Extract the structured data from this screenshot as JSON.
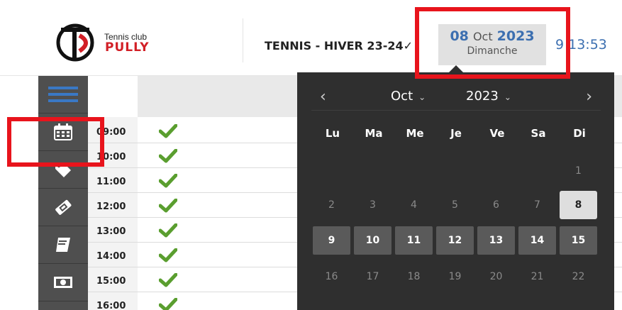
{
  "header": {
    "club_tennis": "Tennis club",
    "club_name": "PULLY",
    "season_label": "TENNIS - HIVER 23-24",
    "season_chevron": "✓",
    "date": {
      "day": "08",
      "month": "Oct",
      "year": "2023",
      "weekday": "Dimanche"
    },
    "clock": "9 13:53"
  },
  "sidebar": {
    "items": [
      "menu-icon",
      "calendar-icon",
      "tag-icon",
      "ticket-icon",
      "book-icon",
      "money-icon"
    ]
  },
  "schedule": {
    "times": [
      "09:00",
      "10:00",
      "11:00",
      "12:00",
      "13:00",
      "14:00",
      "15:00",
      "16:00"
    ]
  },
  "datepicker": {
    "prev": "‹",
    "next": "›",
    "month": "Oct",
    "year": "2023",
    "chevron": "⌄",
    "weekdays": [
      "Lu",
      "Ma",
      "Me",
      "Je",
      "Ve",
      "Sa",
      "Di"
    ],
    "weeks": [
      [
        "",
        "",
        "",
        "",
        "",
        "",
        "1"
      ],
      [
        "2",
        "3",
        "4",
        "5",
        "6",
        "7",
        "8"
      ],
      [
        "9",
        "10",
        "11",
        "12",
        "13",
        "14",
        "15"
      ],
      [
        "16",
        "17",
        "18",
        "19",
        "20",
        "21",
        "22"
      ]
    ],
    "selected": "8"
  },
  "colors": {
    "accent": "#3c6fb0",
    "highlight_red": "#e8141c",
    "check_green": "#5a9e2f",
    "sidebar": "#4f4f4f",
    "picker_bg": "#2f2f2f"
  }
}
